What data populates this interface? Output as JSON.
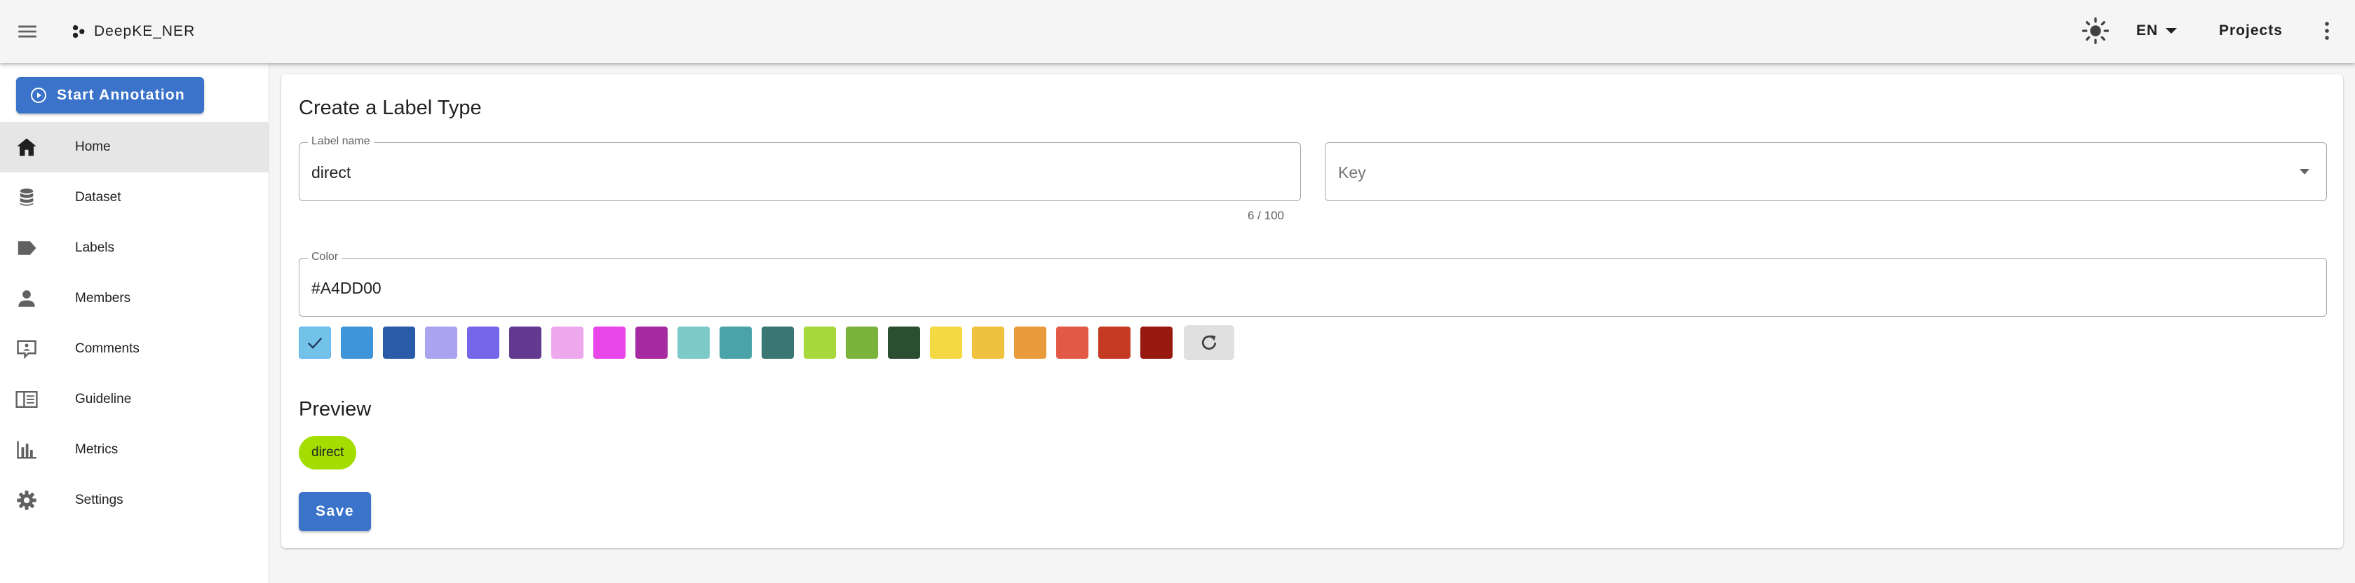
{
  "app": {
    "title": "DeepKE_NER",
    "language": "EN",
    "projects_label": "Projects"
  },
  "icons": {
    "menu": "hamburger-menu-icon",
    "brand": "dots-logo-icon",
    "theme": "brightness-icon",
    "lang_dropdown": "caret-down-icon",
    "more": "dots-vertical-icon",
    "start": "play-circle-icon"
  },
  "sidebar": {
    "start_button": "Start Annotation",
    "items": [
      {
        "label": "Home",
        "icon": "home-icon",
        "active": true
      },
      {
        "label": "Dataset",
        "icon": "database-icon",
        "active": false
      },
      {
        "label": "Labels",
        "icon": "label-icon",
        "active": false
      },
      {
        "label": "Members",
        "icon": "account-icon",
        "active": false
      },
      {
        "label": "Comments",
        "icon": "comment-icon",
        "active": false
      },
      {
        "label": "Guideline",
        "icon": "book-icon",
        "active": false
      },
      {
        "label": "Metrics",
        "icon": "chart-bar-icon",
        "active": false
      },
      {
        "label": "Settings",
        "icon": "cog-icon",
        "active": false
      }
    ]
  },
  "form": {
    "title": "Create a Label Type",
    "label_name": {
      "label": "Label name",
      "value": "direct",
      "counter": "6 / 100"
    },
    "key": {
      "placeholder": "Key"
    },
    "color": {
      "label": "Color",
      "value": "#A4DD00"
    },
    "swatches": [
      "#73c2e8",
      "#3f95d9",
      "#2a5ba8",
      "#a8a4ef",
      "#7466e8",
      "#633a90",
      "#eea8ee",
      "#e846e8",
      "#a62ba0",
      "#7ec9c9",
      "#4aa3a8",
      "#397674",
      "#a8d93c",
      "#7ab33c",
      "#2b4e33",
      "#f5d943",
      "#f0c13c",
      "#e99a3a",
      "#e25a46",
      "#c53a22",
      "#97190f"
    ],
    "selected_swatch": 0,
    "preview_title": "Preview",
    "preview_chip": "direct",
    "preview_color": "#A4DD00",
    "save_label": "Save"
  }
}
